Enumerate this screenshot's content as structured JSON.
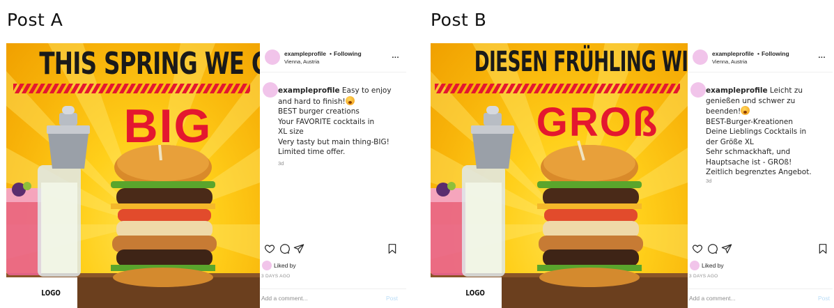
{
  "posts": [
    {
      "heading": "Post A",
      "image": {
        "headline": "THIS SPRING WE GO",
        "big_word": "BIG",
        "logo": "LOGO"
      },
      "header": {
        "username": "exampleprofile",
        "dot": "•",
        "follow": "Following",
        "location": "Vienna, Austria",
        "more": "..."
      },
      "caption": {
        "username": "exampleprofile",
        "first_line": "Easy to enjoy",
        "lines": [
          "and hard to finish!",
          "BEST burger creations",
          "Your FAVORITE cocktails in",
          "XL size",
          "Very tasty but main thing-BIG!",
          "Limited time offer."
        ],
        "time": "3d"
      },
      "liked_by": "Liked by",
      "days_ago": "3 DAYS AGO",
      "comment_placeholder": "Add a comment...",
      "post_button": "Post"
    },
    {
      "heading": "Post B",
      "image": {
        "headline": "DIESEN FRÜHLING WIRD ES",
        "big_word": "GROß",
        "logo": "LOGO"
      },
      "header": {
        "username": "exampleprofile",
        "dot": "•",
        "follow": "Following",
        "location": "Vienna, Austria",
        "more": "..."
      },
      "caption": {
        "username": "exampleprofile",
        "first_line": "Leicht zu",
        "lines": [
          "genießen und schwer zu",
          "beenden!",
          "BEST-Burger-Kreationen",
          "Deine Lieblings Cocktails in",
          "der Größe XL",
          "Sehr schmackhaft, und",
          "Hauptsache ist - GROß!",
          "Zeitlich begrenztes Angebot."
        ],
        "time": "3d"
      },
      "liked_by": "Liked by",
      "days_ago": "3 DAYS AGO",
      "comment_placeholder": "Add a comment...",
      "post_button": "Post"
    }
  ],
  "colors": {
    "avatar": "#f1c4ea",
    "headline_red": "#e4172f",
    "background_yellow": "#ffcf1a",
    "post_button": "#b9dcf7"
  },
  "icons": {
    "heart": "heart-icon",
    "comment": "comment-icon",
    "share": "paper-plane-icon",
    "save": "bookmark-icon",
    "more": "more-options-icon",
    "emoji": "emoji-icon"
  }
}
